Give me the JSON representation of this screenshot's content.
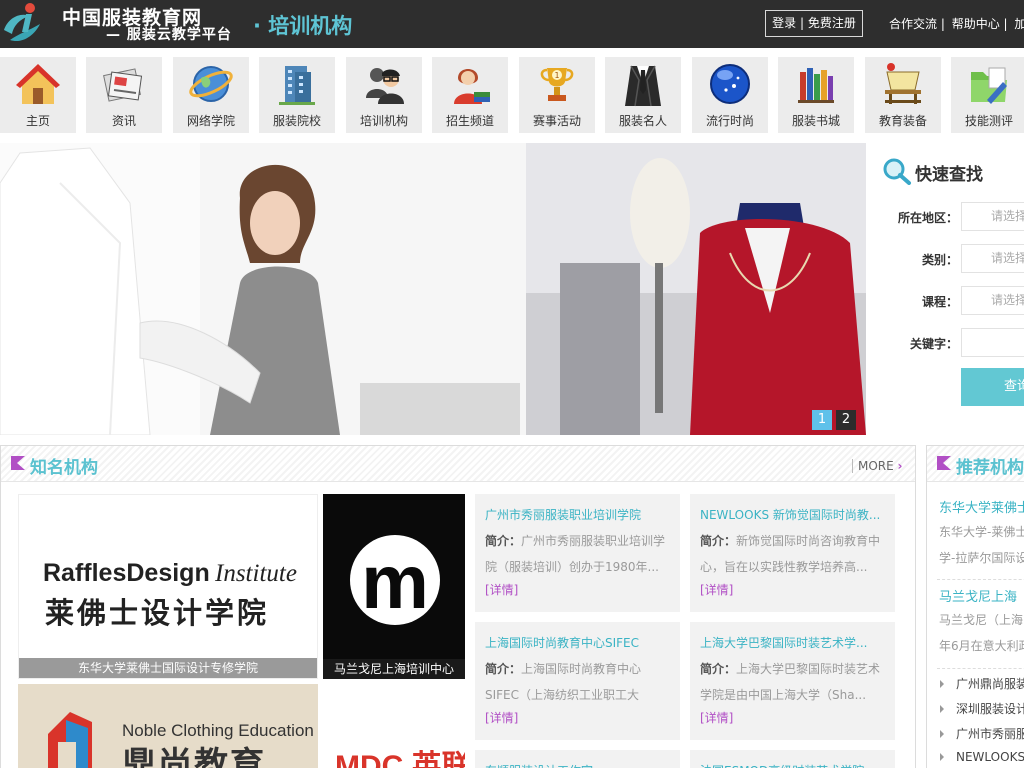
{
  "header": {
    "site_name": "中国服装教育网",
    "site_sub": "— 服装云教学平台",
    "section_title": "· 培训机构",
    "login": "登录 | 免费注册",
    "links": [
      "合作交流 |",
      "帮助中心 |",
      "加"
    ]
  },
  "nav": {
    "items": [
      {
        "label": "主页",
        "icon": "home-icon"
      },
      {
        "label": "资讯",
        "icon": "news-icon"
      },
      {
        "label": "网络学院",
        "icon": "globe-icon"
      },
      {
        "label": "服装院校",
        "icon": "building-icon"
      },
      {
        "label": "培训机构",
        "icon": "people-icon"
      },
      {
        "label": "招生频道",
        "icon": "student-icon"
      },
      {
        "label": "赛事活动",
        "icon": "trophy-icon"
      },
      {
        "label": "服装名人",
        "icon": "suit-icon"
      },
      {
        "label": "流行时尚",
        "icon": "orb-icon"
      },
      {
        "label": "服装书城",
        "icon": "books-icon"
      },
      {
        "label": "教育装备",
        "icon": "equipment-icon"
      },
      {
        "label": "技能测评",
        "icon": "folder-icon"
      }
    ]
  },
  "banner": {
    "pages": [
      "1",
      "2"
    ],
    "active": 0
  },
  "quick_search": {
    "title": "快速查找",
    "fields": [
      {
        "label": "所在地区：",
        "placeholder": "请选择"
      },
      {
        "label": "类别：",
        "placeholder": "请选择"
      },
      {
        "label": "课程：",
        "placeholder": "请选择"
      },
      {
        "label": "关键字：",
        "placeholder": ""
      }
    ],
    "button": "查询"
  },
  "famous": {
    "title": "知名机构",
    "more": "MORE",
    "more_arrow": "›",
    "logos": [
      {
        "line1": "RafflesDesign",
        "line1b": "Institute",
        "line2": "莱佛士设计学院",
        "caption": "东华大学莱佛士国际设计专修学院"
      },
      {
        "letter": "m",
        "caption": "马兰戈尼上海培训中心"
      },
      {
        "en": "Noble Clothing Education",
        "cn": "鼎尚教育"
      },
      {
        "text": "MDC 英联"
      }
    ],
    "intro_label": "简介：",
    "detail_label": "[详情]",
    "cards": [
      {
        "name": "广州市秀丽服装职业培训学院",
        "intro": "广州市秀丽服装职业培训学院（服装培训）创办于1980年..."
      },
      {
        "name": "NEWLOOKS 新饰觉国际时尚教...",
        "intro": "新饰觉国际时尚咨询教育中心，旨在以实践性教学培养高..."
      },
      {
        "name": "上海国际时尚教育中心SIFEC",
        "intro": "上海国际时尚教育中心SIFEC（上海纺织工业职工大"
      },
      {
        "name": "上海大学巴黎国际时装艺术学...",
        "intro": "上海大学巴黎国际时装艺术学院是由中国上海大学（Sha..."
      },
      {
        "name": "东顺服装设计工作室",
        "intro": ""
      },
      {
        "name": "法国ESMOD高级时装艺术学院",
        "intro": ""
      }
    ]
  },
  "recommended": {
    "title": "推荐机构",
    "featured": [
      {
        "name": "东华大学莱佛士",
        "desc1": "东华大学-莱佛士",
        "desc2": "学-拉萨尔国际设"
      },
      {
        "name": "马兰戈尼上海",
        "desc1": "马兰戈尼（上海",
        "desc2": "年6月在意大利政"
      }
    ],
    "list": [
      "广州鼎尚服装",
      "深圳服装设计",
      "广州市秀丽服",
      "NEWLOOKS"
    ]
  },
  "colors": {
    "accent": "#5bc2d0",
    "link": "#3ab3c4",
    "detail": "#b14fc5",
    "header_bg": "#2e2e2e"
  }
}
